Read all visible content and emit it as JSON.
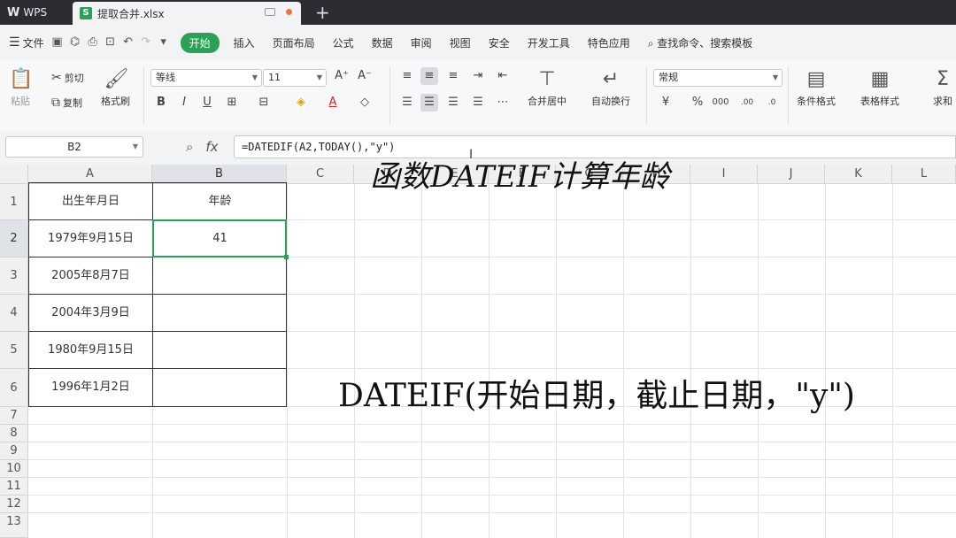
{
  "titlebar": {
    "app_name": "WPS",
    "file_tab": "提取合并.xlsx"
  },
  "menubar": {
    "file_menu": "文件",
    "tabs": [
      "开始",
      "插入",
      "页面布局",
      "公式",
      "数据",
      "审阅",
      "视图",
      "安全",
      "开发工具",
      "特色应用"
    ],
    "active_tab": "开始",
    "search": "查找命令、搜索模板"
  },
  "ribbon": {
    "paste": "粘贴",
    "cut": "剪切",
    "copy": "复制",
    "format_painter": "格式刷",
    "font_name": "等线",
    "font_size": "11",
    "merge_center": "合并居中",
    "wrap_text": "自动换行",
    "number_format": "常规",
    "conditional_format": "条件格式",
    "table_style": "表格样式",
    "sum": "求和"
  },
  "formula_bar": {
    "name_box": "B2",
    "formula": "=DATEDIF(A2,TODAY(),\"y\")"
  },
  "sheet": {
    "columns": [
      "A",
      "B",
      "C",
      "D",
      "E",
      "F",
      "G",
      "H",
      "I",
      "J",
      "K",
      "L"
    ],
    "rows": [
      "1",
      "2",
      "3",
      "4",
      "5",
      "6",
      "7",
      "8",
      "9",
      "10",
      "11",
      "12",
      "13"
    ],
    "headers": {
      "birth_date": "出生年月日",
      "age": "年龄"
    },
    "data": [
      {
        "birth": "1979年9月15日",
        "age": "41"
      },
      {
        "birth": "2005年8月7日",
        "age": ""
      },
      {
        "birth": "2004年3月9日",
        "age": ""
      },
      {
        "birth": "1980年9月15日",
        "age": ""
      },
      {
        "birth": "1996年1月2日",
        "age": ""
      }
    ]
  },
  "annotations": {
    "title": "函数DATEIF计算年龄",
    "syntax": "DATEIF(开始日期，截止日期，\"y\")"
  },
  "colors": {
    "accent": "#2aa157"
  }
}
